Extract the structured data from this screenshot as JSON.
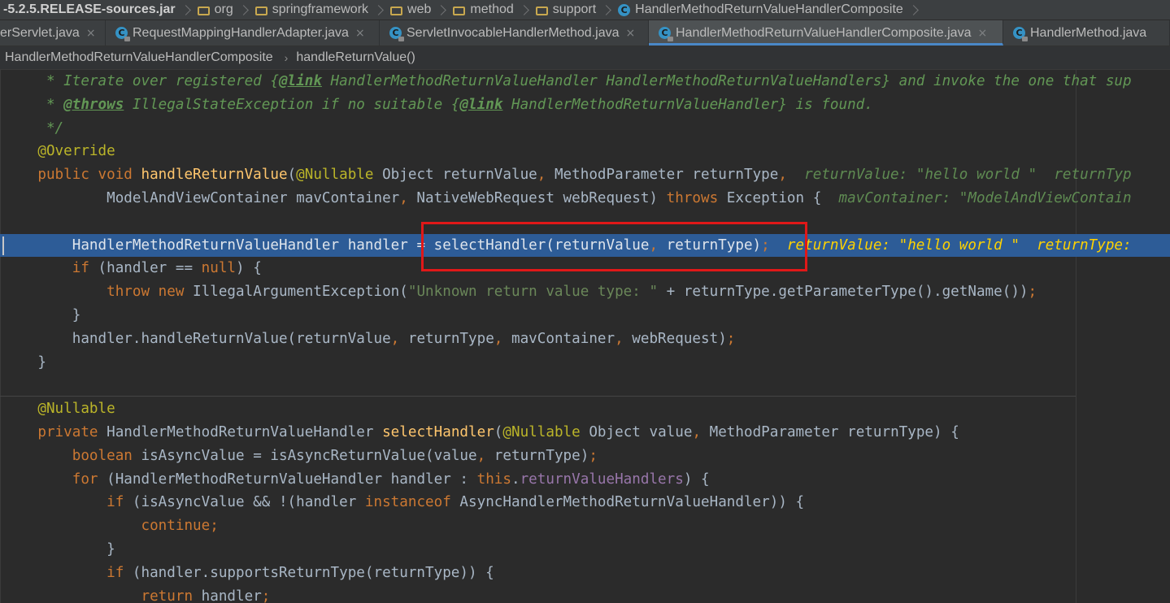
{
  "navbar": {
    "crumbs": [
      "-5.2.5.RELEASE-sources.jar",
      "org",
      "springframework",
      "web",
      "method",
      "support",
      "HandlerMethodReturnValueHandlerComposite"
    ]
  },
  "tabs": [
    {
      "label": "erServlet.java",
      "active": false
    },
    {
      "label": "RequestMappingHandlerAdapter.java",
      "active": false
    },
    {
      "label": "ServletInvocableHandlerMethod.java",
      "active": false
    },
    {
      "label": "HandlerMethodReturnValueHandlerComposite.java",
      "active": true
    },
    {
      "label": "HandlerMethod.java",
      "active": false
    }
  ],
  "tab_close_glyph": "×",
  "class_icon_letter": "C",
  "breadcrumb": {
    "class_name": "HandlerMethodReturnValueHandlerComposite",
    "separator": "›",
    "method": "handleReturnValue()"
  },
  "colors": {
    "background": "#2b2b2b",
    "keyword": "#cc7832",
    "method": "#ffc66d",
    "annotation": "#bbb529",
    "doc_comment": "#629755",
    "selection": "#2d5c97",
    "highlight_box": "#e01818"
  },
  "icons": {
    "folder": "folder-icon",
    "class": "class-icon",
    "close": "close-icon"
  },
  "code": {
    "l0": {
      "t1": " * Iterate over registered {",
      "t2": "@link",
      "t3": " HandlerMethodReturnValueHandler HandlerMethodReturnValueHandlers} and invoke the one that sup"
    },
    "l1": {
      "t1": " * ",
      "t2": "@throws",
      "t3": " IllegalStateException if no suitable {",
      "t4": "@link",
      "t5": " HandlerMethodReturnValueHandler} is found."
    },
    "l2": {
      "t1": " */"
    },
    "l3": {
      "t1": "@Override"
    },
    "l4": {
      "t1": "public void ",
      "t2": "handleReturnValue",
      "t3": "(",
      "t4": "@Nullable",
      "t5": " Object returnValue",
      "t6": ",",
      "t7": " MethodParameter returnType",
      "t8": ",",
      "t9": "  returnValue: \"hello world \"  returnTyp"
    },
    "l5": {
      "t1": "ModelAndViewContainer mavContainer",
      "t2": ",",
      "t3": " NativeWebRequest webRequest) ",
      "t4": "throws",
      "t5": " Exception {",
      "t6": "  mavContainer: \"ModelAndViewContain"
    },
    "l7": {
      "t1": "HandlerMethodReturnValueHandler handler = selectHandler(returnValue",
      "t2": ",",
      "t3": " returnType)",
      "t4": ";",
      "t5": "  returnValue: \"hello world \"  returnType:"
    },
    "l8": {
      "t1": "if",
      "t2": " (handler == ",
      "t3": "null",
      "t4": ") {"
    },
    "l9": {
      "t1": "throw new",
      "t2": " IllegalArgumentException(",
      "t3": "\"Unknown return value type: \"",
      "t4": " + returnType.getParameterType().getName())",
      "t5": ";"
    },
    "l10": {
      "t1": "}"
    },
    "l11": {
      "t1": "handler.handleReturnValue(returnValue",
      "t2": ",",
      "t3": " returnType",
      "t4": ",",
      "t5": " mavContainer",
      "t6": ",",
      "t7": " webRequest)",
      "t8": ";"
    },
    "l12": {
      "t1": "}"
    },
    "l14": {
      "t1": "@Nullable"
    },
    "l15": {
      "t1": "private",
      "t2": " HandlerMethodReturnValueHandler ",
      "t3": "selectHandler",
      "t4": "(",
      "t5": "@Nullable",
      "t6": " Object value",
      "t7": ",",
      "t8": " MethodParameter returnType) {"
    },
    "l16": {
      "t1": "boolean",
      "t2": " isAsyncValue = isAsyncReturnValue(value",
      "t3": ",",
      "t4": " returnType)",
      "t5": ";"
    },
    "l17": {
      "t1": "for",
      "t2": " (HandlerMethodReturnValueHandler handler : ",
      "t3": "this",
      "t4": ".",
      "t5": "returnValueHandlers",
      "t6": ") {"
    },
    "l18": {
      "t1": "if",
      "t2": " (isAsyncValue && !(handler ",
      "t3": "instanceof",
      "t4": " AsyncHandlerMethodReturnValueHandler)) {"
    },
    "l19": {
      "t1": "continue",
      "t2": ";"
    },
    "l20": {
      "t1": "}"
    },
    "l21": {
      "t1": "if",
      "t2": " (handler.supportsReturnType(returnType)) {"
    },
    "l22": {
      "t1": "return",
      "t2": " handler",
      "t3": ";"
    }
  }
}
